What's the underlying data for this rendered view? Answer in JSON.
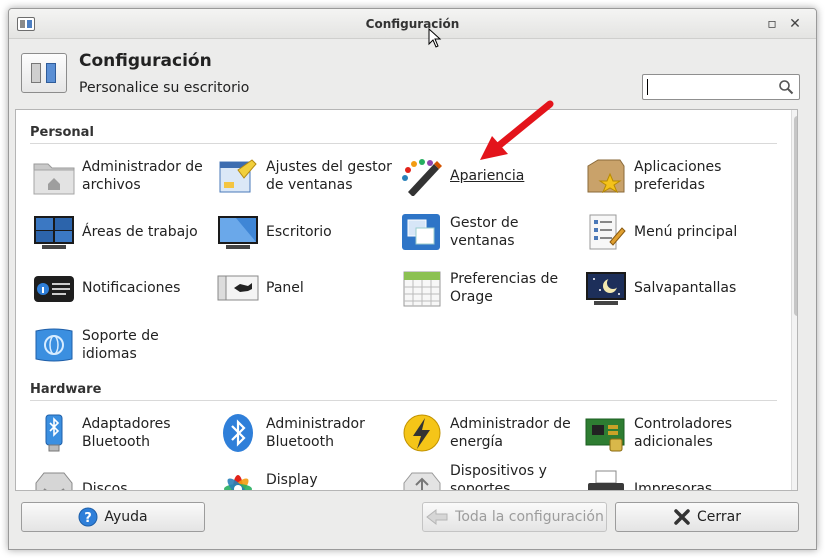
{
  "window": {
    "title": "Configuración"
  },
  "header": {
    "title": "Configuración",
    "subtitle": "Personalice su escritorio"
  },
  "search": {
    "value": "",
    "placeholder": ""
  },
  "sections": {
    "personal": "Personal",
    "hardware": "Hardware"
  },
  "personal_items": [
    {
      "line1": "Administrador de",
      "line2": "archivos",
      "icon": "folder-home-icon"
    },
    {
      "line1": "Ajustes del gestor",
      "line2": "de ventanas",
      "icon": "window-manager-tweaks-icon"
    },
    {
      "line1": "Apariencia",
      "line2": "",
      "icon": "palette-brush-icon"
    },
    {
      "line1": "Aplicaciones",
      "line2": "preferidas",
      "icon": "preferred-apps-star-icon"
    },
    {
      "line1": "Áreas de trabajo",
      "line2": "",
      "icon": "workspaces-monitor-icon"
    },
    {
      "line1": "Escritorio",
      "line2": "",
      "icon": "desktop-monitor-icon"
    },
    {
      "line1": "Gestor de",
      "line2": "ventanas",
      "icon": "window-manager-icon"
    },
    {
      "line1": "Menú principal",
      "line2": "",
      "icon": "menu-editor-icon"
    },
    {
      "line1": "Notificaciones",
      "line2": "",
      "icon": "notifications-icon"
    },
    {
      "line1": "Panel",
      "line2": "",
      "icon": "panel-icon"
    },
    {
      "line1": "Preferencias de",
      "line2": "Orage",
      "icon": "calendar-icon"
    },
    {
      "line1": "Salvapantallas",
      "line2": "",
      "icon": "screensaver-moon-icon"
    },
    {
      "line1": "Soporte de",
      "line2": "idiomas",
      "icon": "language-flag-icon"
    }
  ],
  "hardware_items": [
    {
      "line1": "Adaptadores",
      "line2": "Bluetooth",
      "icon": "bluetooth-adapter-icon"
    },
    {
      "line1": "Administrador",
      "line2": "Bluetooth",
      "icon": "bluetooth-icon"
    },
    {
      "line1": "Administrador de",
      "line2": "energía",
      "icon": "power-bolt-icon"
    },
    {
      "line1": "Controladores",
      "line2": "adicionales",
      "icon": "drivers-chip-icon"
    },
    {
      "line1": "Discos",
      "line2": "",
      "icon": "disks-icon"
    },
    {
      "line1": "Display Calibration",
      "line2": "",
      "icon": "color-calibration-icon"
    },
    {
      "line1": "Dispositivos y",
      "line2": "soportes extraíbles",
      "icon": "usb-removable-icon"
    },
    {
      "line1": "Impresoras",
      "line2": "",
      "icon": "printer-icon"
    }
  ],
  "footer": {
    "help": "Ayuda",
    "all_settings": "Toda la configuración",
    "close": "Cerrar"
  },
  "colors": {
    "accent_red": "#e3141b",
    "bluetooth_blue": "#2f7fd9"
  }
}
